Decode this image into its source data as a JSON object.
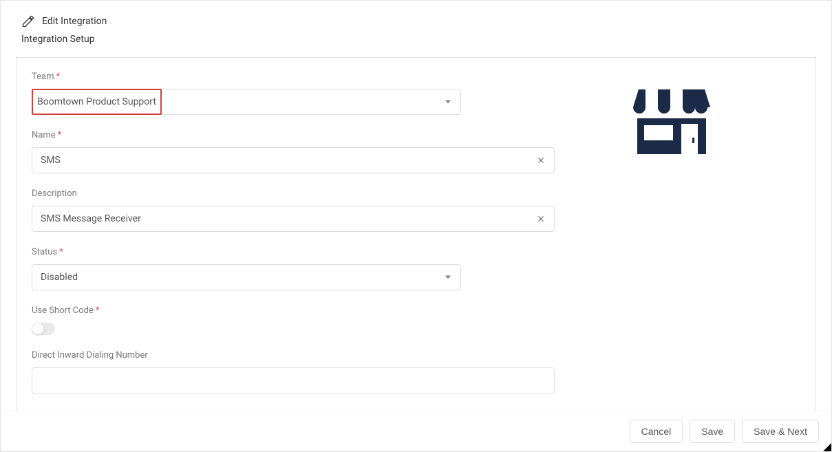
{
  "header": {
    "title": "Edit Integration",
    "subtitle": "Integration Setup"
  },
  "form": {
    "team": {
      "label": "Team",
      "required": true,
      "value": "Boomtown Product Support"
    },
    "name": {
      "label": "Name",
      "required": true,
      "value": "SMS"
    },
    "description": {
      "label": "Description",
      "required": false,
      "value": "SMS Message Receiver"
    },
    "status": {
      "label": "Status",
      "required": true,
      "value": "Disabled"
    },
    "use_short_code": {
      "label": "Use Short Code",
      "required": true,
      "value": false
    },
    "did_number": {
      "label": "Direct Inward Dialing Number",
      "required": false,
      "value": ""
    }
  },
  "footer": {
    "cancel": "Cancel",
    "save": "Save",
    "save_next": "Save & Next"
  },
  "icons": {
    "storefront": "storefront-icon"
  }
}
